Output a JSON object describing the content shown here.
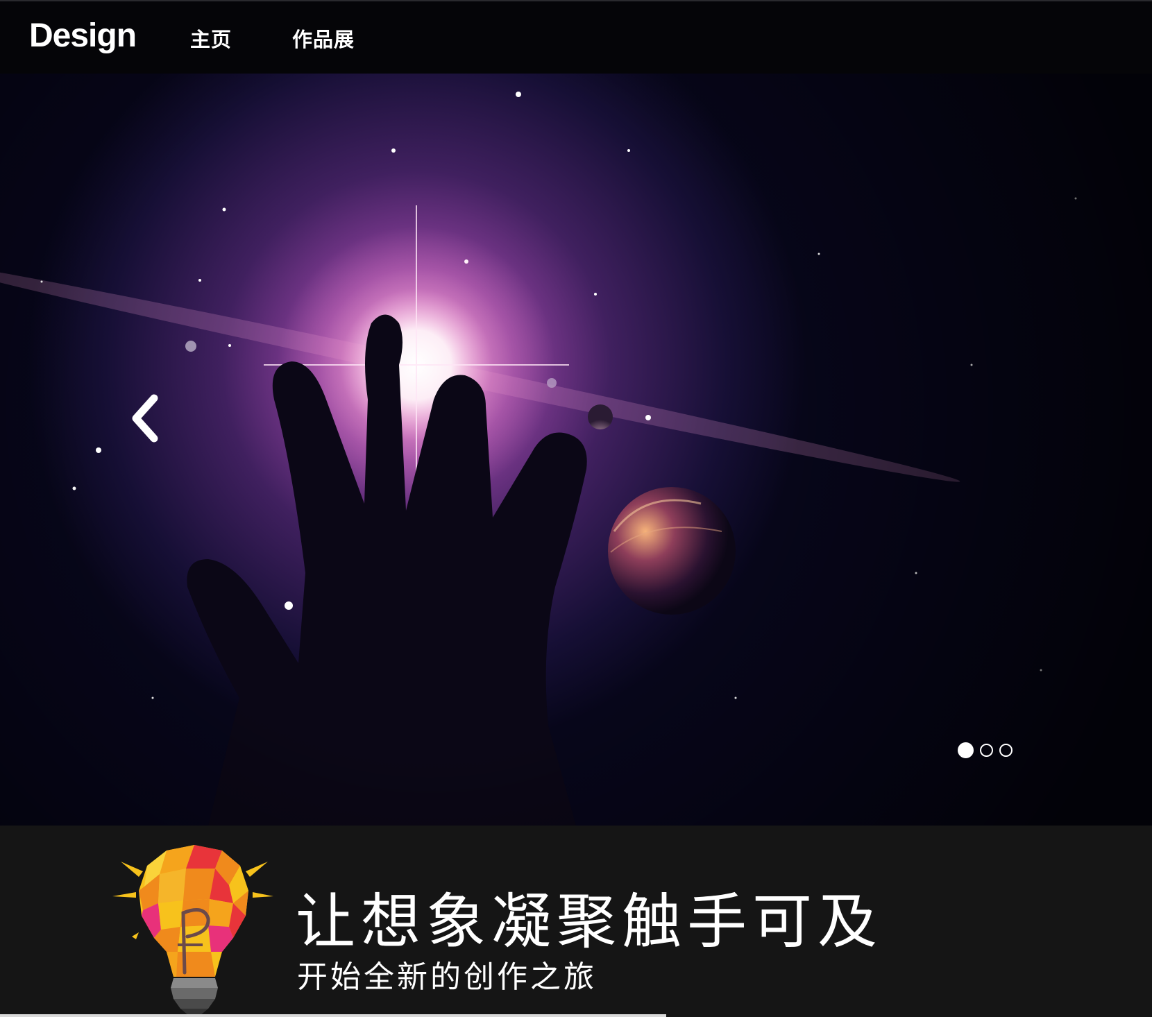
{
  "header": {
    "brand": "Design",
    "nav": [
      {
        "label": "主页"
      },
      {
        "label": "作品展"
      }
    ]
  },
  "carousel": {
    "prev_icon": "chevron-left-icon",
    "slide_count": 3,
    "active_index": 0
  },
  "banner": {
    "logo_icon": "lightbulb-logo-icon",
    "logo_letter": "P",
    "headline": "让想象凝聚触手可及",
    "subline": "开始全新的创作之旅"
  },
  "colors": {
    "topbar": "#050508",
    "hero_bg": "#07061a",
    "banner_bg": "#151515",
    "text": "#ffffff",
    "bulb_yellow": "#f7c21c",
    "bulb_orange": "#f08a1c",
    "bulb_red": "#e8343a",
    "bulb_pink": "#e8317a"
  }
}
